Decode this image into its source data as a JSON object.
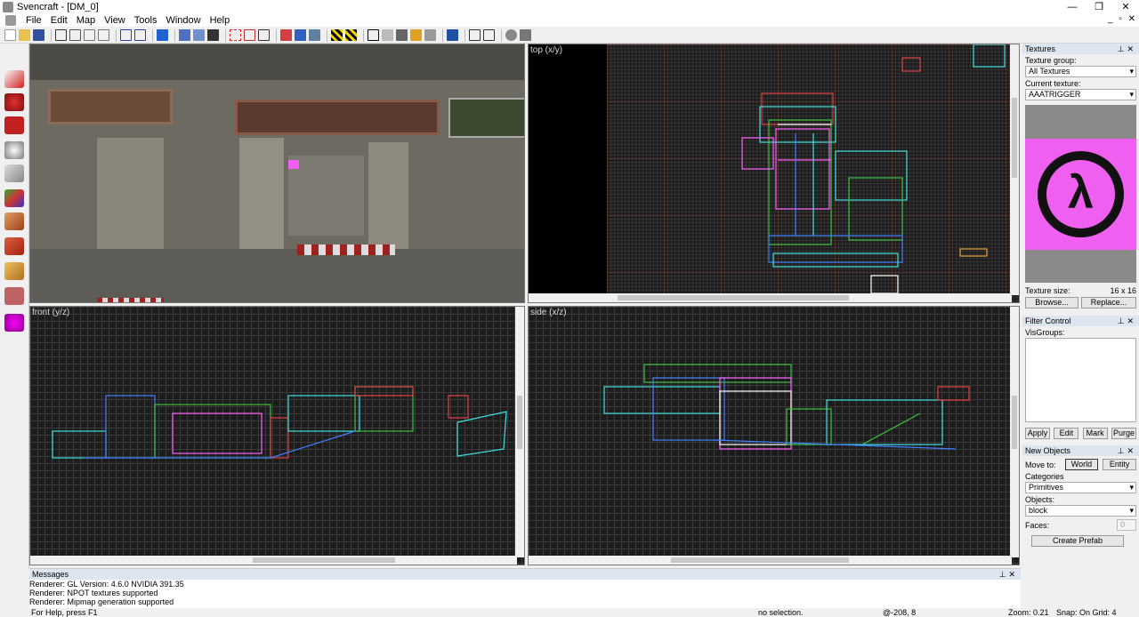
{
  "window": {
    "title": "Svencraft - [DM_0]",
    "minimize": "—",
    "maximize": "❐",
    "close": "✕"
  },
  "menu": {
    "items": [
      "File",
      "Edit",
      "Map",
      "View",
      "Tools",
      "Window",
      "Help"
    ],
    "mdi_controls": "_ ▫ ✕"
  },
  "viewports": {
    "camera": {
      "label": ""
    },
    "top": {
      "label": "top (x/y)"
    },
    "front": {
      "label": "front (y/z)"
    },
    "side": {
      "label": "side (x/z)"
    }
  },
  "textures_panel": {
    "title": "Textures",
    "group_label": "Texture group:",
    "group_value": "All Textures",
    "current_label": "Current texture:",
    "current_value": "AAATRIGGER",
    "size_label": "Texture size:",
    "size_value": "16 x 16",
    "browse": "Browse...",
    "replace": "Replace..."
  },
  "filter_panel": {
    "title": "Filter Control",
    "visgroups_label": "VisGroups:",
    "buttons": [
      "Apply",
      "Edit",
      "Mark",
      "Purge"
    ]
  },
  "new_objects_panel": {
    "title": "New Objects",
    "move_to_label": "Move to:",
    "world": "World",
    "entity": "Entity",
    "categories_label": "Categories",
    "categories_value": "Primitives",
    "objects_label": "Objects:",
    "objects_value": "block",
    "faces_label": "Faces:",
    "faces_value": "0",
    "create_prefab": "Create Prefab"
  },
  "messages": {
    "title": "Messages",
    "lines": [
      "Renderer: GL Version: 4.6.0 NVIDIA 391.35",
      "Renderer: NPOT textures supported",
      "Renderer: Mipmap generation supported"
    ]
  },
  "status": {
    "help": "For Help, press F1",
    "selection": "no selection.",
    "coords": "@-208, 8",
    "zoom": "Zoom: 0.21",
    "snap": "Snap: On Grid: 4"
  },
  "colors": {
    "accent_panel_header": "#dde6f0",
    "texture_pink": "#f060f0"
  }
}
